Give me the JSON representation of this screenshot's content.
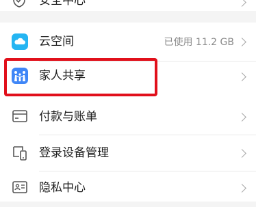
{
  "settings": {
    "security_center": {
      "label": "安全中心",
      "icon": "shield-check-icon"
    },
    "cloud_space": {
      "label": "云空间",
      "value": "已使用 11.2 GB",
      "icon": "cloud-icon",
      "icon_color": "#25b5f2"
    },
    "family_sharing": {
      "label": "家人共享",
      "icon": "family-icon",
      "icon_color": "#3f86f7"
    },
    "payment_billing": {
      "label": "付款与账单",
      "icon": "payment-card-icon"
    },
    "login_devices": {
      "label": "登录设备管理",
      "icon": "devices-icon"
    },
    "privacy_center": {
      "label": "隐私中心",
      "icon": "privacy-card-icon"
    }
  },
  "highlight": {
    "target": "family_sharing",
    "color": "#e1101b"
  }
}
